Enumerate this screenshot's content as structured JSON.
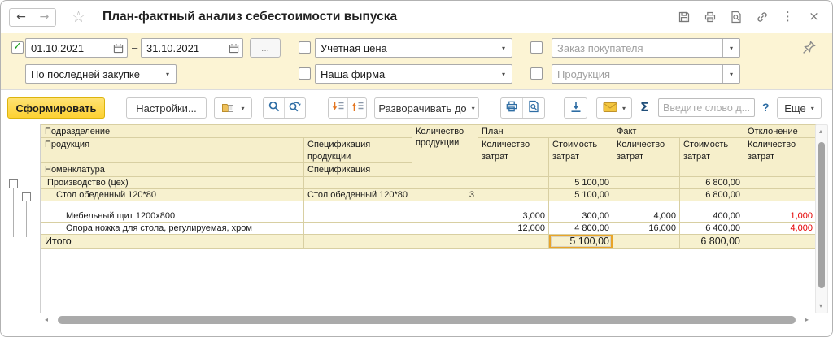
{
  "titlebar": {
    "title": "План-фактный анализ себестоимости выпуска"
  },
  "icons": {
    "back": "←",
    "forward": "→",
    "star": "☆",
    "more_vertical": "⋮",
    "close": "×",
    "dropdown": "▾",
    "check": "✓",
    "scroll_up": "▴",
    "scroll_down": "▾",
    "scroll_left": "◂",
    "scroll_right": "▸"
  },
  "filters": {
    "period_from": "01.10.2021",
    "period_to": "31.10.2021",
    "period_dash": "–",
    "period_more": "...",
    "price_basis": "По последней закупке",
    "price_type": "Учетная цена",
    "firm": "Наша фирма",
    "customer_order_placeholder": "Заказ покупателя",
    "production_placeholder": "Продукция"
  },
  "toolbar": {
    "generate": "Сформировать",
    "settings": "Настройки...",
    "expand_to": "Разворачивать до",
    "sigma": "Σ",
    "search_placeholder": "Введите слово д...",
    "help": "?",
    "more": "Еще"
  },
  "table": {
    "header": {
      "department": "Подразделение",
      "production": "Продукция",
      "production_spec": "Спецификация продукции",
      "nomenclature": "Номенклатура",
      "nomenclature_spec": "Спецификация",
      "qty_production": "Количество продукции",
      "plan": "План",
      "fact": "Факт",
      "deviation": "Отклонение",
      "qty_costs": "Количество затрат",
      "cost_costs": "Стоимость затрат"
    },
    "rows": [
      {
        "name": "Производство (цех)",
        "spec": "",
        "qty": "",
        "plan_qty": "",
        "plan_cost": "5 100,00",
        "fact_qty": "",
        "fact_cost": "6 800,00",
        "dev_qty": ""
      },
      {
        "name": "Стол обеденный 120*80",
        "spec": "Стол обеденный 120*80",
        "qty": "3",
        "plan_qty": "",
        "plan_cost": "5 100,00",
        "fact_qty": "",
        "fact_cost": "6 800,00",
        "dev_qty": ""
      },
      {
        "name": "",
        "spec": "",
        "qty": "",
        "plan_qty": "",
        "plan_cost": "",
        "fact_qty": "",
        "fact_cost": "",
        "dev_qty": ""
      },
      {
        "name": "Мебельный щит 1200х800",
        "spec": "",
        "qty": "",
        "plan_qty": "3,000",
        "plan_cost": "300,00",
        "fact_qty": "4,000",
        "fact_cost": "400,00",
        "dev_qty": "1,000"
      },
      {
        "name": "Опора ножка для стола, регулируемая, хром",
        "spec": "",
        "qty": "",
        "plan_qty": "12,000",
        "plan_cost": "4 800,00",
        "fact_qty": "16,000",
        "fact_cost": "6 400,00",
        "dev_qty": "4,000"
      }
    ],
    "total": {
      "label": "Итого",
      "plan_cost": "5 100,00",
      "fact_cost": "6 800,00"
    }
  }
}
